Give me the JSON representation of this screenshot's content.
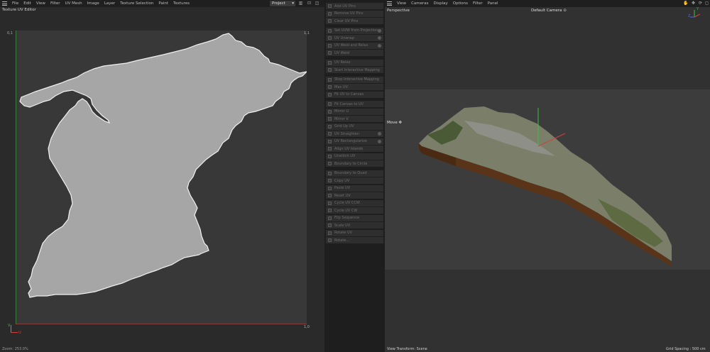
{
  "left_panel": {
    "menu": [
      "File",
      "Edit",
      "View",
      "Filter",
      "UV Mesh",
      "Image",
      "Layer",
      "Texture Selection",
      "Paint",
      "Textures"
    ],
    "project_select": "Project",
    "title": "Texture UV Editor",
    "corner_top_left": "0,1",
    "corner_top_right": "1,1",
    "corner_bottom_right": "1,0",
    "axis_u": "U",
    "axis_v": "V",
    "zoom": "Zoom: 253.0%"
  },
  "tools": [
    {
      "label": "Add UV Pins",
      "gear": false
    },
    {
      "label": "Remove UV Pins",
      "gear": false
    },
    {
      "label": "Clear UV Pins",
      "gear": false
    },
    {
      "label": "Set UVW from Projection",
      "gear": true
    },
    {
      "label": "UV Unwrap",
      "gear": true
    },
    {
      "label": "UV Weld and Relax",
      "gear": true
    },
    {
      "label": "UV Weld",
      "gear": false
    },
    {
      "label": "UV Relax",
      "gear": false
    },
    {
      "label": "Start Interactive Mapping",
      "gear": false
    },
    {
      "label": "Stop Interactive Mapping",
      "gear": false
    },
    {
      "label": "Max UV",
      "gear": false
    },
    {
      "label": "Fit UV to Canvas",
      "gear": false
    },
    {
      "label": "Fit Canvas to UV",
      "gear": false
    },
    {
      "label": "Mirror U",
      "gear": false
    },
    {
      "label": "Mirror V",
      "gear": false
    },
    {
      "label": "Grid Up UV",
      "gear": false
    },
    {
      "label": "UV Straighten",
      "gear": true
    },
    {
      "label": "UV Rectangularize",
      "gear": true
    },
    {
      "label": "Align UV Islands",
      "gear": false
    },
    {
      "label": "Unstitch UV",
      "gear": false
    },
    {
      "label": "Boundary to Circle",
      "gear": false
    },
    {
      "label": "Boundary to Quad",
      "gear": false
    },
    {
      "label": "Copy UV",
      "gear": false
    },
    {
      "label": "Paste UV",
      "gear": false
    },
    {
      "label": "Reset UV",
      "gear": false
    },
    {
      "label": "Cycle UV CCW",
      "gear": false
    },
    {
      "label": "Cycle UV CW",
      "gear": false
    },
    {
      "label": "Flip Sequence",
      "gear": false
    },
    {
      "label": "Scale UV",
      "gear": false
    },
    {
      "label": "Rotate UV",
      "gear": false
    },
    {
      "label": "Rotate...",
      "gear": false
    }
  ],
  "viewport": {
    "menu": [
      "View",
      "Cameras",
      "Display",
      "Options",
      "Filter",
      "Panel"
    ],
    "label": "Perspective",
    "camera": "Default Camera",
    "move_label": "Move",
    "view_transform": "View Transform: Scene",
    "grid_spacing": "Grid Spacing : 500 cm",
    "axis_y": "Y",
    "axis_z": "Z"
  },
  "colors": {
    "uv_island": "#a6a6a6",
    "uv_axis_v": "#3bbf3b",
    "uv_axis_u": "#d04040",
    "terrain_side": "#5a3418"
  }
}
